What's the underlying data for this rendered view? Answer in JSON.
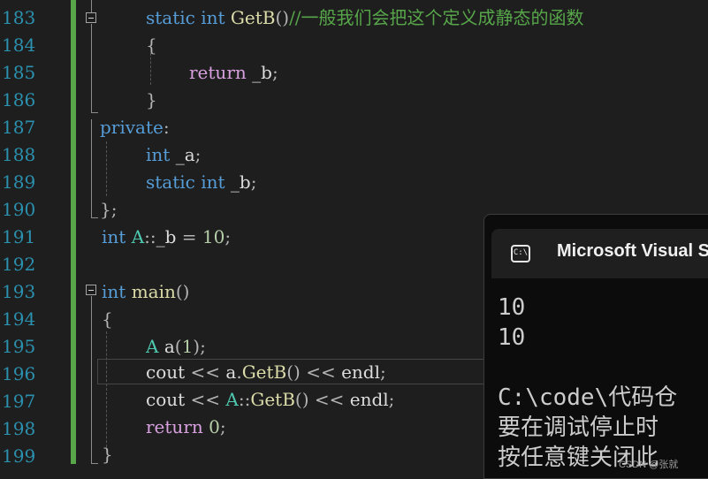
{
  "gutter": {
    "line_numbers": [
      "183",
      "184",
      "185",
      "186",
      "187",
      "188",
      "189",
      "190",
      "191",
      "192",
      "193",
      "194",
      "195",
      "196",
      "197",
      "198",
      "199"
    ]
  },
  "code": {
    "l183": {
      "kw1": "static",
      "kw2": "int",
      "fn": "GetB",
      "p": "()",
      "cm": "//一般我们会把这个定义成静态的函数"
    },
    "l184": {
      "p": "{"
    },
    "l185": {
      "ctl": "return",
      "var": "_b",
      "p": ";"
    },
    "l186": {
      "p": "}"
    },
    "l187": {
      "kw": "private",
      "p": ":"
    },
    "l188": {
      "kw": "int",
      "var": "_a",
      "p": ";"
    },
    "l189": {
      "kw1": "static",
      "kw2": "int",
      "var": "_b",
      "p": ";"
    },
    "l190": {
      "p": "};"
    },
    "l191": {
      "kw": "int",
      "cls": "A",
      "sep": "::",
      "var": "_b",
      "eq": " = ",
      "num": "10",
      "p": ";"
    },
    "l193": {
      "kw": "int",
      "fn": "main",
      "p": "()"
    },
    "l194": {
      "p": "{"
    },
    "l195": {
      "cls": "A",
      "var": "a",
      "p1": "(",
      "num": "1",
      "p2": ");"
    },
    "l196": {
      "var1": "cout",
      "op1": " << ",
      "var2": "a",
      "dot": ".",
      "fn": "GetB",
      "p": "()",
      "op2": " << ",
      "var3": "endl",
      "end": ";"
    },
    "l197": {
      "var1": "cout",
      "op1": " << ",
      "cls": "A",
      "sep": "::",
      "fn": "GetB",
      "p": "()",
      "op2": " << ",
      "var3": "endl",
      "end": ";"
    },
    "l198": {
      "ctl": "return",
      "num": "0",
      "p": ";"
    },
    "l199": {
      "p": "}"
    }
  },
  "console": {
    "title": "Microsoft Visual S",
    "icon_text": "C:\\",
    "lines": [
      "10",
      "10",
      "",
      "C:\\code\\代码仓",
      "要在调试停止时",
      "按任意键关闭此"
    ]
  },
  "watermark": "CSDN @张就"
}
